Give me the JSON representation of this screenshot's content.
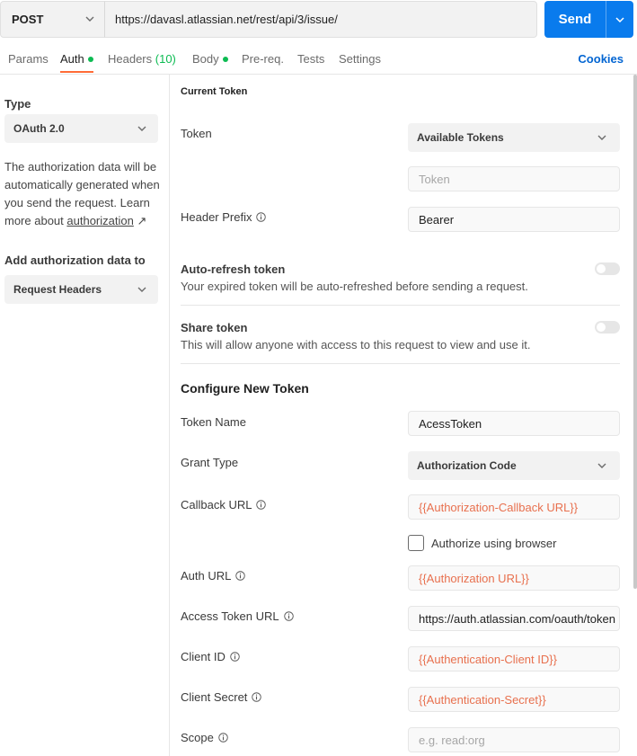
{
  "request": {
    "method": "POST",
    "url": "https://davasl.atlassian.net/rest/api/3/issue/",
    "send_label": "Send"
  },
  "tabs": {
    "params": "Params",
    "auth": "Auth",
    "headers": "Headers",
    "headers_count": "(10)",
    "body": "Body",
    "prereq": "Pre-req.",
    "tests": "Tests",
    "settings": "Settings",
    "cookies": "Cookies"
  },
  "left": {
    "type_label": "Type",
    "type_value": "OAuth 2.0",
    "description": "The authorization data will be automatically generated when you send the request. Learn more about",
    "link_text": "authorization",
    "link_arrow": "↗",
    "add_label": "Add authorization data to",
    "add_value": "Request Headers"
  },
  "current_token": {
    "title": "Current Token",
    "token_label": "Token",
    "available_tokens": "Available Tokens",
    "token_placeholder": "Token",
    "header_prefix_label": "Header Prefix",
    "header_prefix_value": "Bearer",
    "auto_refresh_title": "Auto-refresh token",
    "auto_refresh_desc": "Your expired token will be auto-refreshed before sending a request.",
    "share_title": "Share token",
    "share_desc": "This will allow anyone with access to this request to view and use it."
  },
  "new_token": {
    "title": "Configure New Token",
    "token_name_label": "Token Name",
    "token_name_value": "AcessToken",
    "grant_type_label": "Grant Type",
    "grant_type_value": "Authorization Code",
    "callback_label": "Callback URL",
    "callback_value": "{{Authorization-Callback URL}}",
    "authorize_browser_label": "Authorize using browser",
    "auth_url_label": "Auth URL",
    "auth_url_value": "{{Authorization URL}}",
    "access_token_url_label": "Access Token URL",
    "access_token_url_value": "https://auth.atlassian.com/oauth/token",
    "client_id_label": "Client ID",
    "client_id_value": "{{Authentication-Client ID}}",
    "client_secret_label": "Client Secret",
    "client_secret_value": "{{Authentication-Secret}}",
    "scope_label": "Scope",
    "scope_placeholder": "e.g. read:org"
  },
  "colors": {
    "primary": "#097bed",
    "accent": "#ff6c37",
    "status_green": "#0cbb52",
    "variable": "#e8704e",
    "link": "#0265d2"
  }
}
